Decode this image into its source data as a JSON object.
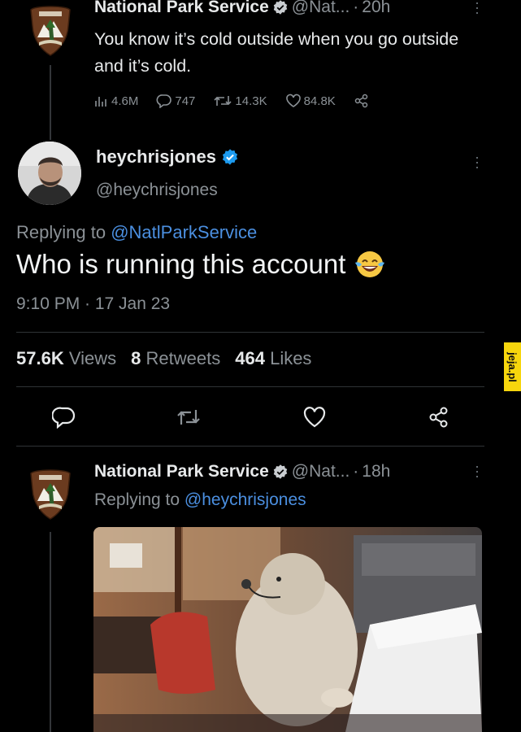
{
  "tweet1": {
    "name": "National Park Service",
    "handle": "@Nat...",
    "dot": "·",
    "time": "20h",
    "text": "You know it’s cold outside when you go outside and it’s cold.",
    "stats": {
      "views": "4.6M",
      "replies": "747",
      "retweets": "14.3K",
      "likes": "84.8K"
    }
  },
  "main_tweet": {
    "name": "heychrisjones",
    "handle": "@heychrisjones",
    "replying_prefix": "Replying to",
    "replying_to": "@NatlParkService",
    "text": "Who is running this account",
    "timestamp": "9:10 PM · 17 Jan 23",
    "counts": {
      "views_value": "57.6K",
      "views_label": "Views",
      "retweets_value": "8",
      "retweets_label": "Retweets",
      "likes_value": "464",
      "likes_label": "Likes"
    }
  },
  "reply_tweet": {
    "name": "National Park Service",
    "handle": "@Nat...",
    "dot": "·",
    "time": "18h",
    "replying_prefix": "Replying to",
    "replying_to": "@heychrisjones"
  },
  "watermark": "jeja.pl",
  "colors": {
    "background": "#000000",
    "text": "#e7e9ea",
    "muted": "#8b9196",
    "link": "#4b8fe0",
    "verified": "#1d9bf0"
  }
}
